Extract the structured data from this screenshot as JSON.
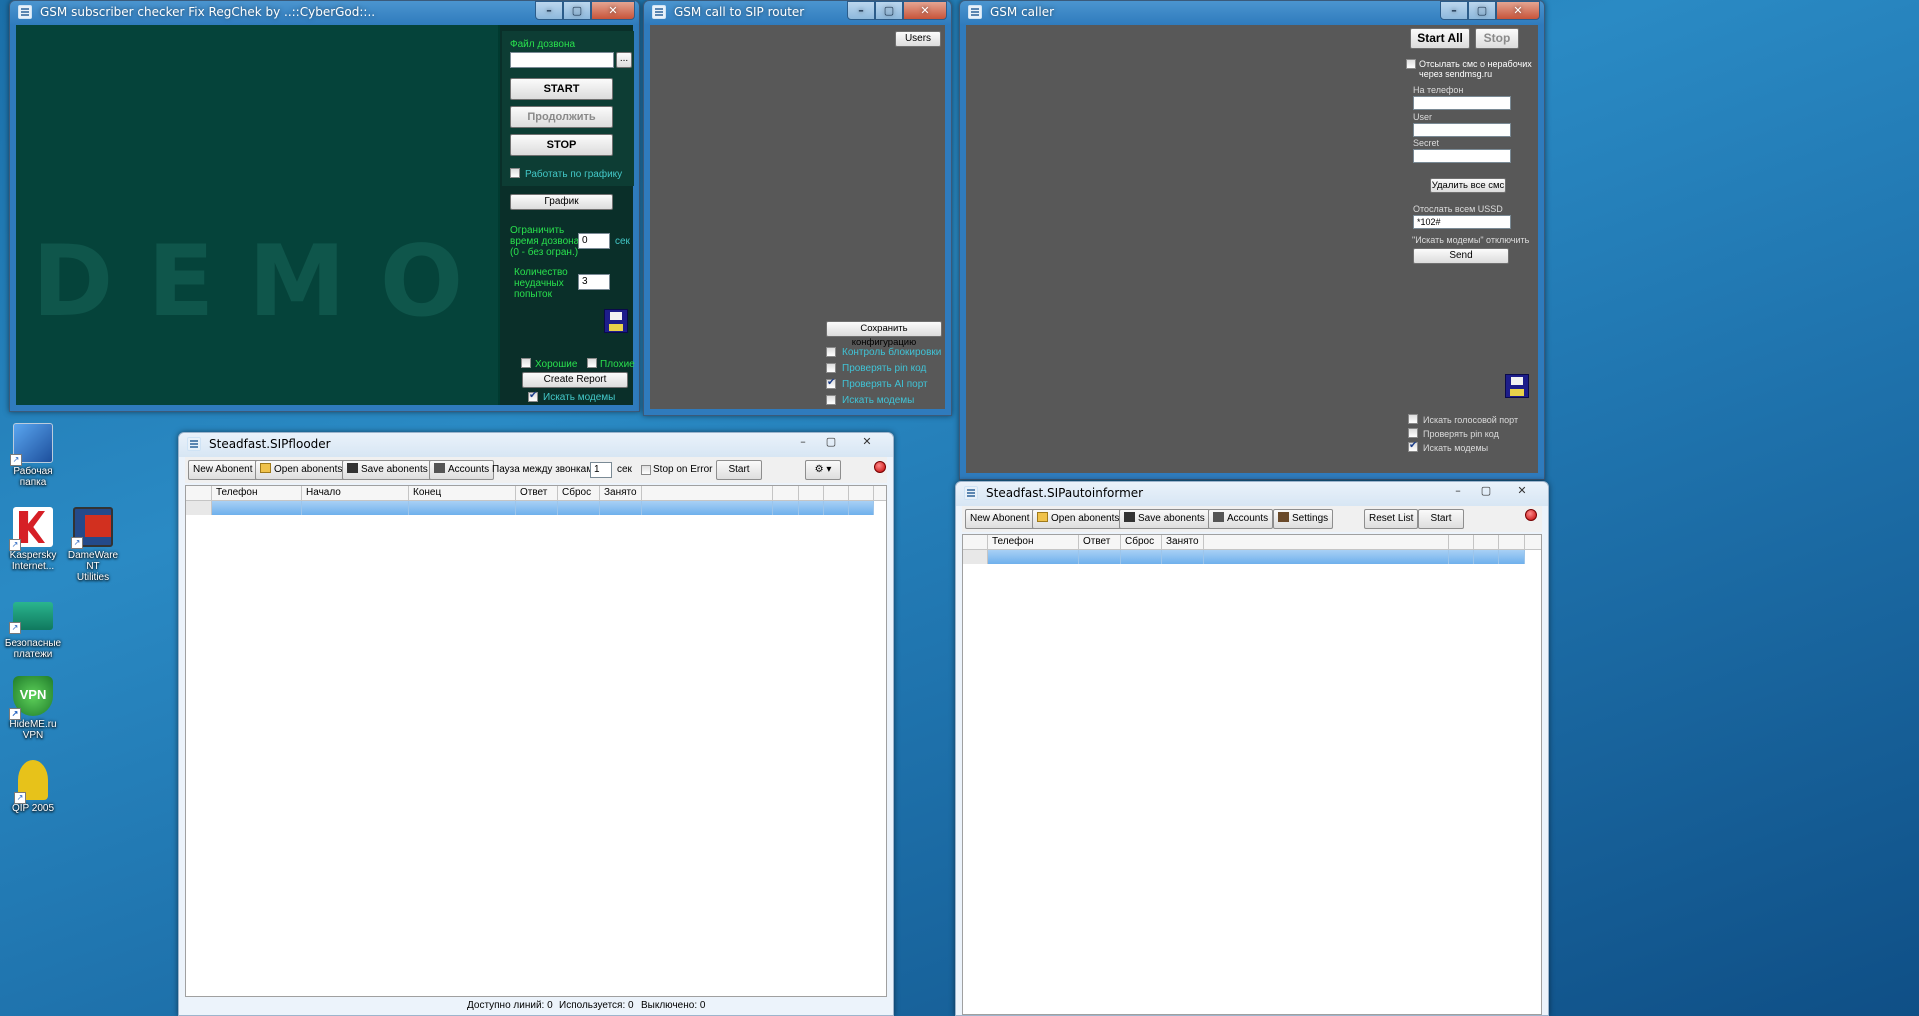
{
  "checker": {
    "title": "GSM subscriber checker Fix RegChek by ..::CyberGod::..",
    "demo": "DEMO",
    "file_label": "Файл дозвона",
    "file_value": "",
    "browse_btn": "...",
    "start_btn": "START",
    "continue_btn": "Продолжить",
    "stop_btn": "STOP",
    "schedule_check": "Работать по графику",
    "schedule_btn": "График",
    "limit_label_1": "Ограничить",
    "limit_label_2": "время дозвона",
    "limit_label_3": "(0 - без огран.)",
    "limit_value": "0",
    "limit_unit": "сек",
    "attempts_label_1": "Количество",
    "attempts_label_2": "неудачных",
    "attempts_label_3": "попыток",
    "attempts_value": "3",
    "good_check": "Хорошие",
    "bad_check": "Плохие",
    "report_btn": "Create Report",
    "search_modems": "Искать модемы"
  },
  "router": {
    "title": "GSM call to SIP router",
    "users_btn": "Users",
    "save_btn": "Сохранить конфигурацию",
    "checks": [
      "Контроль блокировки",
      "Проверять pin код",
      "Проверять AI порт",
      "Искать модемы"
    ]
  },
  "caller": {
    "title": "GSM caller",
    "start_all_btn": "Start All",
    "stop_btn": "Stop",
    "sms_check_1": "Отсылать смс о нерабочих",
    "sms_check_2": "через sendmsg.ru",
    "phone_label": "На телефон",
    "user_label": "User",
    "secret_label": "Secret",
    "delete_sms_btn": "Удалить все смс",
    "ussd_label": "Отослать всем USSD",
    "ussd_value": "*102#",
    "modems_off_label": "\"Искать модемы\" отключить",
    "send_btn": "Send",
    "checks": [
      "Искать голосовой порт",
      "Проверять pin код",
      "Искать модемы"
    ]
  },
  "flooder": {
    "title": "Steadfast.SIPflooder",
    "new_btn": "New Abonent",
    "open_btn": "Open abonents",
    "save_btn": "Save abonents",
    "accounts_btn": "Accounts",
    "pause_label": "Пауза между звонками",
    "pause_value": "1",
    "pause_unit": "сек",
    "stop_on_error": "Stop on Error",
    "start_btn": "Start",
    "columns": [
      "Телефон",
      "Начало",
      "Конец",
      "Ответ",
      "Сброс",
      "Занято"
    ],
    "status_lines": "Доступно линий: 0",
    "status_used": "Используется: 0",
    "status_off": "Выключено: 0"
  },
  "informer": {
    "title": "Steadfast.SIPautoinformer",
    "new_btn": "New Abonent",
    "open_btn": "Open abonents",
    "save_btn": "Save abonents",
    "accounts_btn": "Accounts",
    "settings_btn": "Settings",
    "reset_btn": "Reset List",
    "start_btn": "Start",
    "columns": [
      "Телефон",
      "Ответ",
      "Сброс",
      "Занято"
    ]
  },
  "desktop_icons": [
    {
      "label_1": "Рабочая",
      "label_2": "папка",
      "icon": "folder-icon",
      "color": "#2f6fd0"
    },
    {
      "label_1": "Kaspersky",
      "label_2": "Internet...",
      "icon": "kaspersky-icon",
      "color": "#d61f26"
    },
    {
      "label_1": "DameWare NT",
      "label_2": "Utilities",
      "icon": "dameware-icon",
      "color": "#c52a1a"
    },
    {
      "label_1": "Безопасные",
      "label_2": "платежи",
      "icon": "payments-icon",
      "color": "#1b9a7a"
    },
    {
      "label_1": "HideME.ru",
      "label_2": "VPN",
      "icon": "vpn-icon",
      "color": "#2fa53a"
    },
    {
      "label_1": "QIP 2005",
      "label_2": "",
      "icon": "qip-icon",
      "color": "#e7c21a"
    }
  ]
}
